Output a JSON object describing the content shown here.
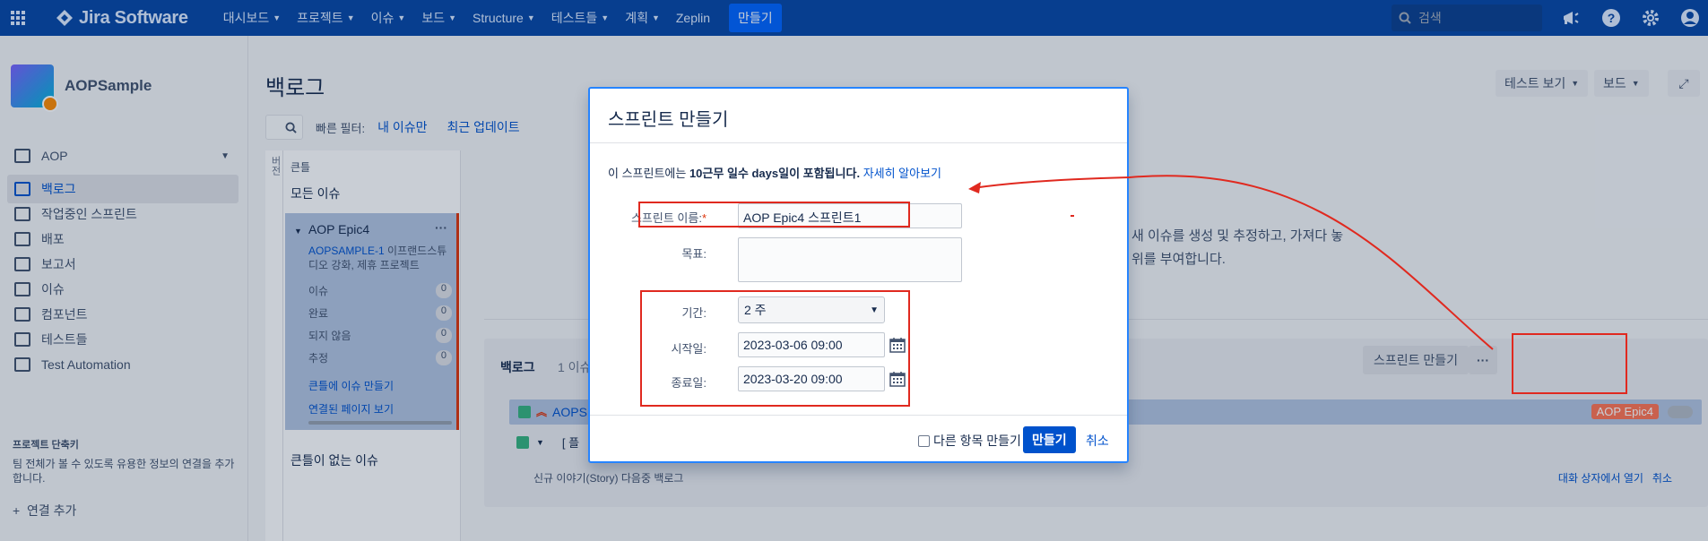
{
  "topnav": {
    "brand": "Jira Software",
    "items": [
      "대시보드",
      "프로젝트",
      "이슈",
      "보드",
      "Structure",
      "테스트들",
      "계획",
      "Zeplin"
    ],
    "items_with_chevron": [
      true,
      true,
      true,
      true,
      true,
      true,
      true,
      false
    ],
    "create": "만들기",
    "search_placeholder": "검색"
  },
  "sidebar": {
    "project_name": "AOPSample",
    "items": [
      {
        "label": "AOP",
        "active": false
      },
      {
        "label": "백로그",
        "active": true
      },
      {
        "label": "작업중인 스프린트",
        "active": false
      },
      {
        "label": "배포",
        "active": false
      },
      {
        "label": "보고서",
        "active": false
      },
      {
        "label": "이슈",
        "active": false
      },
      {
        "label": "컴포넌트",
        "active": false
      },
      {
        "label": "테스트들",
        "active": false
      },
      {
        "label": "Test Automation",
        "active": false
      }
    ],
    "shortcuts_title": "프로젝트 단축키",
    "shortcuts_text": "팀 전체가 볼 수 있도록 유용한 정보의 연결을 추가합니다.",
    "add_link": "연결 추가"
  },
  "main": {
    "title": "백로그",
    "test_view": "테스트 보기",
    "board": "보드",
    "quick_filter_label": "빠른 필터:",
    "filter_my_issues": "내 이슈만",
    "filter_recent": "최근 업데이트",
    "epic_vtab": "버전",
    "epic_header": "큰틀",
    "all_issues": "모든 이슈",
    "epic": {
      "title": "AOP Epic4",
      "key": "AOPSAMPLE-1",
      "desc_rest": " 이프랜드스튜디오 강화, 제휴 프로젝트",
      "stats": [
        {
          "label": "이슈",
          "value": "0"
        },
        {
          "label": "완료",
          "value": "0"
        },
        {
          "label": "되지 않음",
          "value": "0"
        },
        {
          "label": "추정",
          "value": "0"
        }
      ],
      "link_create": "큰틀에 이슈 만들기",
      "link_pages": "연결된 페이지 보기"
    },
    "no_epic": "큰틀이 없는 이슈",
    "bg_line1": "새 이슈를 생성 및 추정하고, 가져다 놓",
    "bg_line2": "위를 부여합니다.",
    "backlog_title": "백로그",
    "backlog_count": "1 이슈 -",
    "sprint_btn": "스프린트 만들기",
    "issue_key": "AOPS",
    "issue_epic_badge": "AOP Epic4",
    "create_row_text": "[ 플",
    "story_label": "신규 이야기(Story) 다음중 백로그",
    "open_dialog": "대화 상자에서 열기",
    "cancel": "취소"
  },
  "dialog": {
    "title": "스프린트 만들기",
    "info_prefix": "이 스프린트에는 ",
    "info_bold": "10근무 일수 days일이 포함됩니다.",
    "info_link": "자세히 알아보기",
    "name_label": "스프린트 이름:",
    "name_required": "*",
    "name_value": "AOP Epic4 스프린트1",
    "goal_label": "목표:",
    "goal_value": "",
    "duration_label": "기간:",
    "duration_value": "2 주",
    "start_label": "시작일:",
    "start_value": "2023-03-06 09:00",
    "end_label": "종료일:",
    "end_value": "2023-03-20 09:00",
    "create_another": "다른 항목 만들기",
    "submit": "만들기",
    "cancel": "취소"
  },
  "colors": {
    "nav_bg": "#0747a6",
    "primary": "#0052cc",
    "annotation_red": "#e0291f",
    "epic_badge": "#ff7452"
  }
}
